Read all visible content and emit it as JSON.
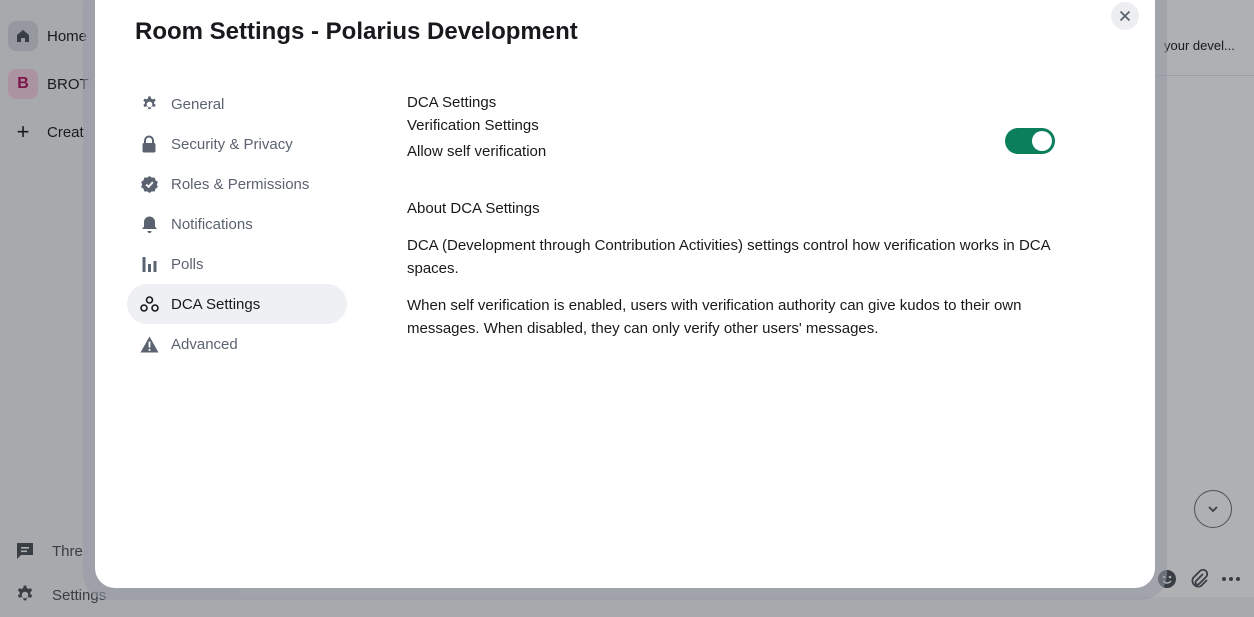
{
  "background": {
    "spaces": [
      {
        "label": "Home",
        "icon": "home-icon"
      },
      {
        "label": "BROT",
        "initial": "B",
        "icon": "space-avatar"
      },
      {
        "label": "Creat",
        "icon": "plus-icon",
        "glyph": "+"
      }
    ],
    "footer": [
      {
        "label": "Thre",
        "icon": "threads-icon"
      },
      {
        "label": "Settings",
        "icon": "gear-icon"
      }
    ],
    "room_topic": "your devel..."
  },
  "dialog": {
    "title": "Room Settings - Polarius Development",
    "close_label": "×",
    "nav": [
      {
        "label": "General",
        "icon": "gear-icon",
        "active": false
      },
      {
        "label": "Security & Privacy",
        "icon": "lock-icon",
        "active": false
      },
      {
        "label": "Roles & Permissions",
        "icon": "badge-check-icon",
        "active": false
      },
      {
        "label": "Notifications",
        "icon": "bell-icon",
        "active": false
      },
      {
        "label": "Polls",
        "icon": "poll-icon",
        "active": false
      },
      {
        "label": "DCA Settings",
        "icon": "dca-icon",
        "active": true
      },
      {
        "label": "Advanced",
        "icon": "warning-icon",
        "active": false
      }
    ],
    "content": {
      "heading": "DCA Settings",
      "subheading": "Verification Settings",
      "toggle_label": "Allow self verification",
      "toggle_on": true,
      "about_heading": "About DCA Settings",
      "para1": "DCA (Development through Contribution Activities) settings control how verification works in DCA spaces.",
      "para2": "When self verification is enabled, users with verification authority can give kudos to their own messages. When disabled, they can only verify other users' messages."
    }
  },
  "colors": {
    "accent": "#0b7f5c",
    "active_nav_bg": "#eef0f4",
    "nav_text": "#5c6370"
  }
}
